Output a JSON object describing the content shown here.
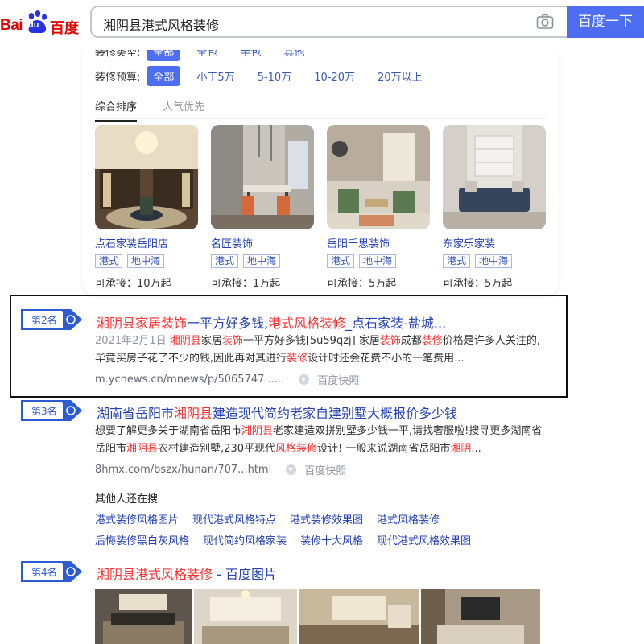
{
  "header": {
    "logo_latin": "Bai",
    "logo_du": "du",
    "logo_cn": "百度",
    "query": "湘阴县港式风格装修",
    "search_button": "百度一下"
  },
  "filters": {
    "type_label": "装修类型:",
    "type_options": [
      "全部",
      "全包",
      "半包",
      "其他"
    ],
    "budget_label": "装修预算:",
    "budget_options": [
      "全部",
      "小于5万",
      "5-10万",
      "10-20万",
      "20万以上"
    ],
    "sort_tabs": [
      "综合排序",
      "人气优先"
    ]
  },
  "companies": [
    {
      "name": "点石家装岳阳店",
      "tags": [
        "港式",
        "地中海"
      ],
      "price": "可承接：10万起"
    },
    {
      "name": "名匠装饰",
      "tags": [
        "港式",
        "地中海"
      ],
      "price": "可承接：1万起"
    },
    {
      "name": "岳阳千思装饰",
      "tags": [
        "港式",
        "地中海"
      ],
      "price": "可承接：5万起"
    },
    {
      "name": "东家乐家装",
      "tags": [
        "港式",
        "地中海"
      ],
      "price": "可承接：5万起"
    }
  ],
  "results": [
    {
      "rank": "第2名",
      "title_parts": [
        "湘阴县家居",
        "装饰",
        "一平方好多钱,",
        "港式风格装修",
        "_点石家装-盐城..."
      ],
      "date": "2021年2月1日",
      "desc_parts": [
        "湘阴县",
        "家居",
        "装饰",
        "一平方好多钱[5u59qzj] 家居",
        "装饰",
        "成都",
        "装修",
        "价格是许多人关注的,毕竟买房子花了不少的钱,因此再对其进行",
        "装修",
        "设计时还会花费不小的一笔费用..."
      ],
      "url": "m.ycnews.cn/mnews/p/5065747......",
      "snapshot": "百度快照"
    },
    {
      "rank": "第3名",
      "title_parts": [
        "湖南省岳阳市",
        "湘阴县",
        "建造现代简约老家自建别墅大概报价多少钱"
      ],
      "desc_parts": [
        "想要了解更多关于湖南省岳阳市",
        "湘阴县",
        "老家建造双拼别墅多少钱一平,请找奢服啦!搜寻更多湖南省岳阳市",
        "湘阴县",
        "农村建造别墅,230平现代",
        "风格装修",
        "设计! 一般来说湖南省岳阳市",
        "湘阴",
        "..."
      ],
      "url": "8hmx.com/bszx/hunan/707...html",
      "snapshot": "百度快照"
    },
    {
      "rank": "第4名",
      "title_parts": [
        "湘阴县港式风格装修",
        " - 百度图片"
      ]
    }
  ],
  "others": {
    "title": "其他人还在搜",
    "row1": [
      "港式装修风格图片",
      "现代港式风格特点",
      "港式装修效果图",
      "港式风格装修"
    ],
    "row2": [
      "后悔装修黑白灰风格",
      "现代简约风格家装",
      "装修十大风格",
      "现代港式风格效果图"
    ]
  }
}
